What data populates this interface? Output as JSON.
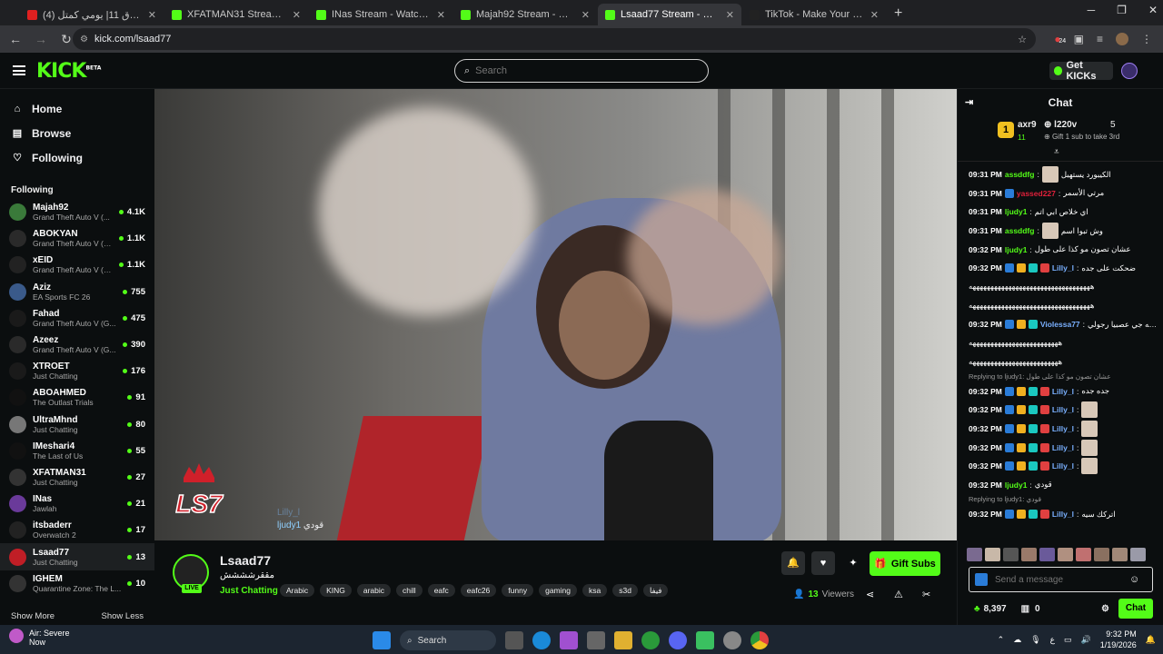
{
  "browser": {
    "tabs": [
      {
        "title": "(4) فلوق 11| يومي كمتل - YouTube",
        "color": "#e02020"
      },
      {
        "title": "XFATMAN31 Stream - Watch Live on Kick",
        "color": "#53fc18"
      },
      {
        "title": "INas Stream - Watch Live on Kick",
        "color": "#53fc18"
      },
      {
        "title": "Majah92 Stream - Watch Live on Kick",
        "color": "#53fc18"
      },
      {
        "title": "Lsaad77 Stream - Watch Live on Kick",
        "color": "#53fc18"
      },
      {
        "title": "TikTok - Make Your Day",
        "color": "#222222"
      }
    ],
    "url": "kick.com/lsaad77",
    "ext_badge": "24"
  },
  "header": {
    "logo": "KICK",
    "logo_sup": "BETA",
    "search_placeholder": "Search",
    "get_kicks": "Get KICKs"
  },
  "sidebar": {
    "nav": [
      {
        "label": "Home",
        "icon": "home-icon"
      },
      {
        "label": "Browse",
        "icon": "browse-icon"
      },
      {
        "label": "Following",
        "icon": "heart-icon"
      }
    ],
    "following_title": "Following",
    "channels": [
      {
        "name": "Majah92",
        "game": "Grand Theft Auto V (...",
        "viewers": "4.1K",
        "color": "#3a7a3a"
      },
      {
        "name": "ABOKYAN",
        "game": "Grand Theft Auto V (G...",
        "viewers": "1.1K",
        "color": "#2a2a2a"
      },
      {
        "name": "xEID",
        "game": "Grand Theft Auto V (G...",
        "viewers": "1.1K",
        "color": "#222"
      },
      {
        "name": "Aziz",
        "game": "EA Sports FC 26",
        "viewers": "755",
        "color": "#3a5a8a"
      },
      {
        "name": "Fahad",
        "game": "Grand Theft Auto V (G...",
        "viewers": "475",
        "color": "#1a1a1a"
      },
      {
        "name": "Azeez",
        "game": "Grand Theft Auto V (G...",
        "viewers": "390",
        "color": "#2a2a2a"
      },
      {
        "name": "XTROET",
        "game": "Just Chatting",
        "viewers": "176",
        "color": "#1a1a1a"
      },
      {
        "name": "ABOAHMED",
        "game": "The Outlast Trials",
        "viewers": "91",
        "color": "#111"
      },
      {
        "name": "UltraMhnd",
        "game": "Just Chatting",
        "viewers": "80",
        "color": "#777"
      },
      {
        "name": "IMeshari4",
        "game": "The Last of Us",
        "viewers": "55",
        "color": "#111"
      },
      {
        "name": "XFATMAN31",
        "game": "Just Chatting",
        "viewers": "27",
        "color": "#333"
      },
      {
        "name": "INas",
        "game": "Jawlah",
        "viewers": "21",
        "color": "#6a3a9a"
      },
      {
        "name": "itsbaderr",
        "game": "Overwatch 2",
        "viewers": "17",
        "color": "#222"
      },
      {
        "name": "Lsaad77",
        "game": "Just Chatting",
        "viewers": "13",
        "color": "#c01e26"
      },
      {
        "name": "IGHEM",
        "game": "Quarantine Zone: The L...",
        "viewers": "10",
        "color": "#333"
      }
    ],
    "show_more": "Show More",
    "show_less": "Show Less"
  },
  "video_overlay": {
    "logo_text": "LS7",
    "chat": [
      {
        "user": "Lilly_l",
        "text": ""
      },
      {
        "user": "ljudy1",
        "text": "قودي"
      }
    ]
  },
  "channel": {
    "name": "Lsaad77",
    "title": "مققرشششش",
    "category": "Just Chatting",
    "live": "LIVE",
    "tags": [
      "Arabic",
      "KING",
      "arabic",
      "chill",
      "eafc",
      "eafc26",
      "funny",
      "gaming",
      "ksa",
      "s3d",
      "فيفا"
    ],
    "gift_subs": "Gift Subs",
    "viewers_count": "13",
    "viewers_label": "Viewers"
  },
  "chat": {
    "title": "Chat",
    "pinned": {
      "user1": "axr9",
      "user1_count": "11",
      "user2": "l220v",
      "user2_count": "5",
      "note": "Gift 1 sub to take 3rd"
    },
    "messages": [
      {
        "time": "09:31 PM",
        "user": "assddfg",
        "color": "#53fc18",
        "text": "الكيبورد يستهبل",
        "emote": true,
        "badges": 0,
        "reply": ""
      },
      {
        "time": "09:31 PM",
        "user": "yassed227",
        "color": "#e0203a",
        "text": "مرتي الأسمر",
        "emote": false,
        "badges": 1,
        "reply": ""
      },
      {
        "time": "09:31 PM",
        "user": "ljudy1",
        "color": "#53fc18",
        "text": "اي خلاص ابي اتم",
        "emote": false,
        "badges": 0,
        "reply": ""
      },
      {
        "time": "09:31 PM",
        "user": "assddfg",
        "color": "#53fc18",
        "text": "وش تبوا اسم",
        "emote": true,
        "badges": 0,
        "reply": ""
      },
      {
        "time": "09:32 PM",
        "user": "ljudy1",
        "color": "#53fc18",
        "text": "عشان تصون مو كذا على طول",
        "emote": false,
        "badges": 0,
        "reply": ""
      },
      {
        "time": "09:32 PM",
        "user": "Lilly_l",
        "color": "#7ab0ff",
        "text": "ضحكت على جده",
        "emote": false,
        "badges": 4,
        "reply": ""
      },
      {
        "time": "",
        "user": "",
        "color": "#fff",
        "text": "ههههههههههههههههههههههههههههههههههه",
        "emote": false,
        "badges": 0,
        "reply": ""
      },
      {
        "time": "",
        "user": "",
        "color": "#fff",
        "text": "ههههههههههههههههههههههههههههههههههه",
        "emote": false,
        "badges": 0,
        "reply": ""
      },
      {
        "time": "09:32 PM",
        "user": "Violessa77",
        "color": "#7ab0ff",
        "text": "سعد استغفرالله كمشي ليه جي عصبيا رجولي",
        "emote": false,
        "badges": 3,
        "reply": ""
      },
      {
        "time": "",
        "user": "",
        "color": "#fff",
        "text": "هههههههههههههههههههههههههه",
        "emote": false,
        "badges": 0,
        "reply": ""
      },
      {
        "time": "",
        "user": "",
        "color": "#fff",
        "text": "هههههههههههههههههههههههههه",
        "emote": false,
        "badges": 0,
        "reply": ""
      },
      {
        "time": "09:32 PM",
        "user": "Lilly_l",
        "color": "#7ab0ff",
        "text": "جده جده",
        "emote": false,
        "badges": 4,
        "reply": "Replying to ljudy1: عشان تصون مو كذا على طول"
      },
      {
        "time": "09:32 PM",
        "user": "Lilly_l",
        "color": "#7ab0ff",
        "text": "",
        "emote": true,
        "badges": 4,
        "reply": ""
      },
      {
        "time": "09:32 PM",
        "user": "Lilly_l",
        "color": "#7ab0ff",
        "text": "",
        "emote": true,
        "badges": 4,
        "reply": ""
      },
      {
        "time": "09:32 PM",
        "user": "Lilly_l",
        "color": "#7ab0ff",
        "text": "",
        "emote": true,
        "badges": 4,
        "reply": ""
      },
      {
        "time": "09:32 PM",
        "user": "Lilly_l",
        "color": "#7ab0ff",
        "text": "",
        "emote": true,
        "badges": 4,
        "reply": ""
      },
      {
        "time": "09:32 PM",
        "user": "ljudy1",
        "color": "#53fc18",
        "text": "قودي",
        "emote": false,
        "badges": 0,
        "reply": ""
      },
      {
        "time": "09:32 PM",
        "user": "Lilly_l",
        "color": "#7ab0ff",
        "text": "اتركك سيه",
        "emote": false,
        "badges": 4,
        "reply": "Replying to ljudy1: قودي"
      }
    ],
    "input_placeholder": "Send a message",
    "kicks": "8,397",
    "gifts": "0",
    "send_label": "Chat"
  },
  "taskbar": {
    "weather_title": "Air: Severe",
    "weather_sub": "Now",
    "search": "Search",
    "time": "9:32 PM",
    "date": "1/19/2026"
  }
}
